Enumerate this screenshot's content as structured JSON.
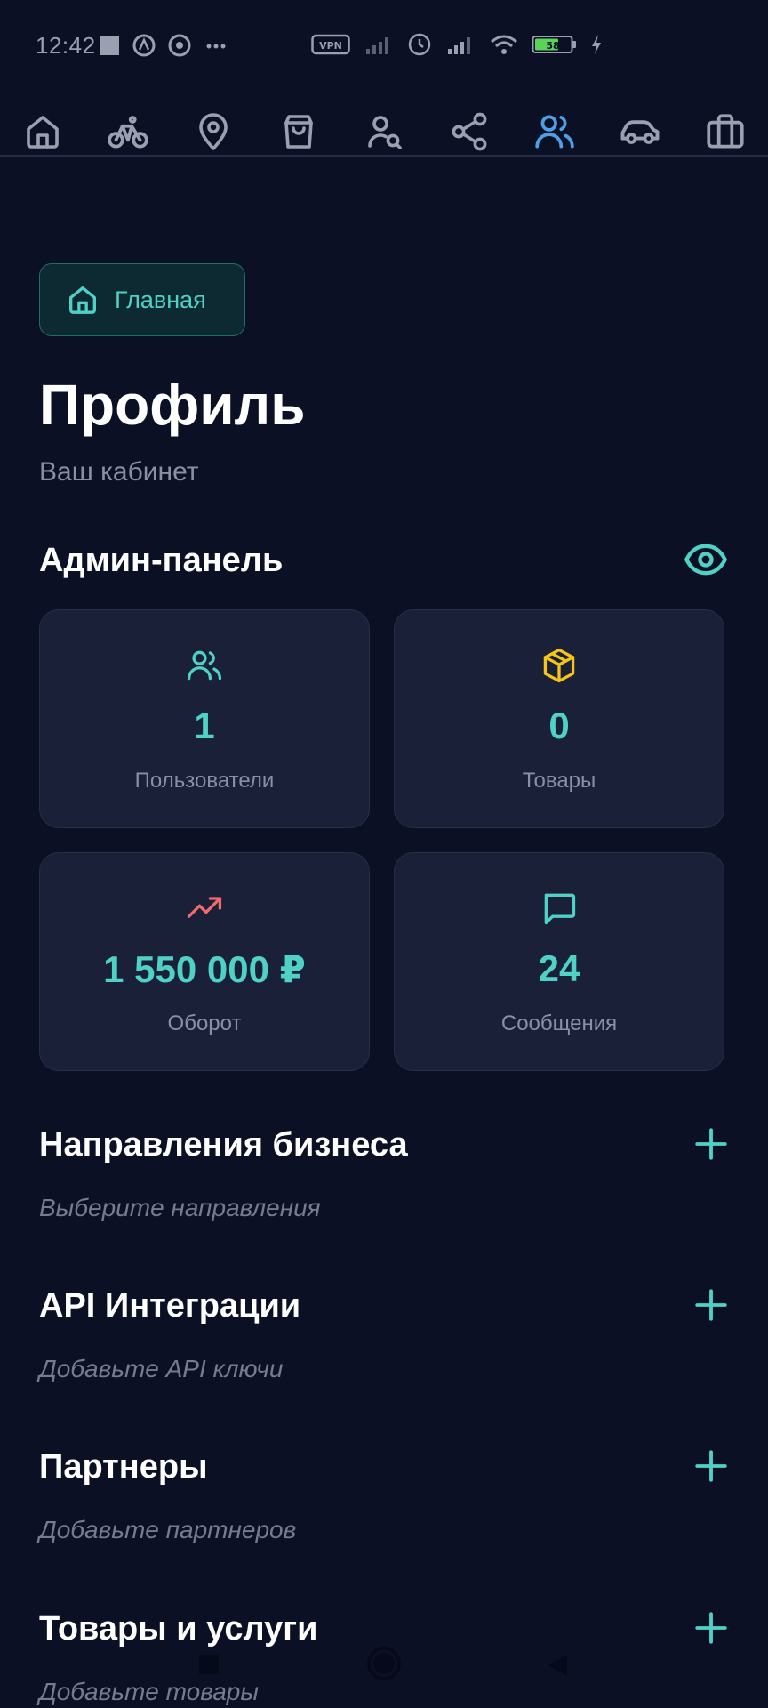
{
  "status_bar": {
    "time": "12:42",
    "battery": "58",
    "icons": [
      "notification-square-icon",
      "app-icon",
      "app-icon-2",
      "more-dots-icon",
      "vpn-icon",
      "signal-icon",
      "alarm-icon",
      "signal-icon-2",
      "wifi-icon",
      "battery-icon",
      "charging-icon"
    ],
    "vpn_label": "VPN"
  },
  "top_nav": {
    "items": [
      {
        "icon": "home-icon"
      },
      {
        "icon": "bicycle-icon"
      },
      {
        "icon": "location-pin-icon"
      },
      {
        "icon": "shopping-bag-icon"
      },
      {
        "icon": "user-search-icon"
      },
      {
        "icon": "share-icon"
      },
      {
        "icon": "users-icon",
        "active": true
      },
      {
        "icon": "car-icon"
      },
      {
        "icon": "briefcase-icon"
      }
    ],
    "active_color": "#4d9fe8",
    "inactive_color": "#9aa0b0"
  },
  "breadcrumb": {
    "label": "Главная"
  },
  "page": {
    "title": "Профиль",
    "subtitle": "Ваш кабинет"
  },
  "admin_panel": {
    "title": "Админ-панель",
    "stats": [
      {
        "icon": "users-icon",
        "value": "1",
        "label": "Пользователи",
        "icon_color": "#4fd1c5"
      },
      {
        "icon": "package-icon",
        "value": "0",
        "label": "Товары",
        "icon_color": "#f5c518"
      },
      {
        "icon": "trending-up-icon",
        "value": "1 550 000 ₽",
        "label": "Оборот",
        "icon_color": "#f26b6b"
      },
      {
        "icon": "message-icon",
        "value": "24",
        "label": "Сообщения",
        "icon_color": "#4fd1c5"
      }
    ]
  },
  "sections": [
    {
      "title": "Направления бизнеса",
      "hint": "Выберите направления"
    },
    {
      "title": "API Интеграции",
      "hint": "Добавьте API ключи"
    },
    {
      "title": "Партнеры",
      "hint": "Добавьте партнеров"
    },
    {
      "title": "Товары и услуги",
      "hint": "Добавьте товары"
    }
  ],
  "colors": {
    "background": "#0b1024",
    "card": "#1a2038",
    "accent": "#4fd1c5"
  }
}
